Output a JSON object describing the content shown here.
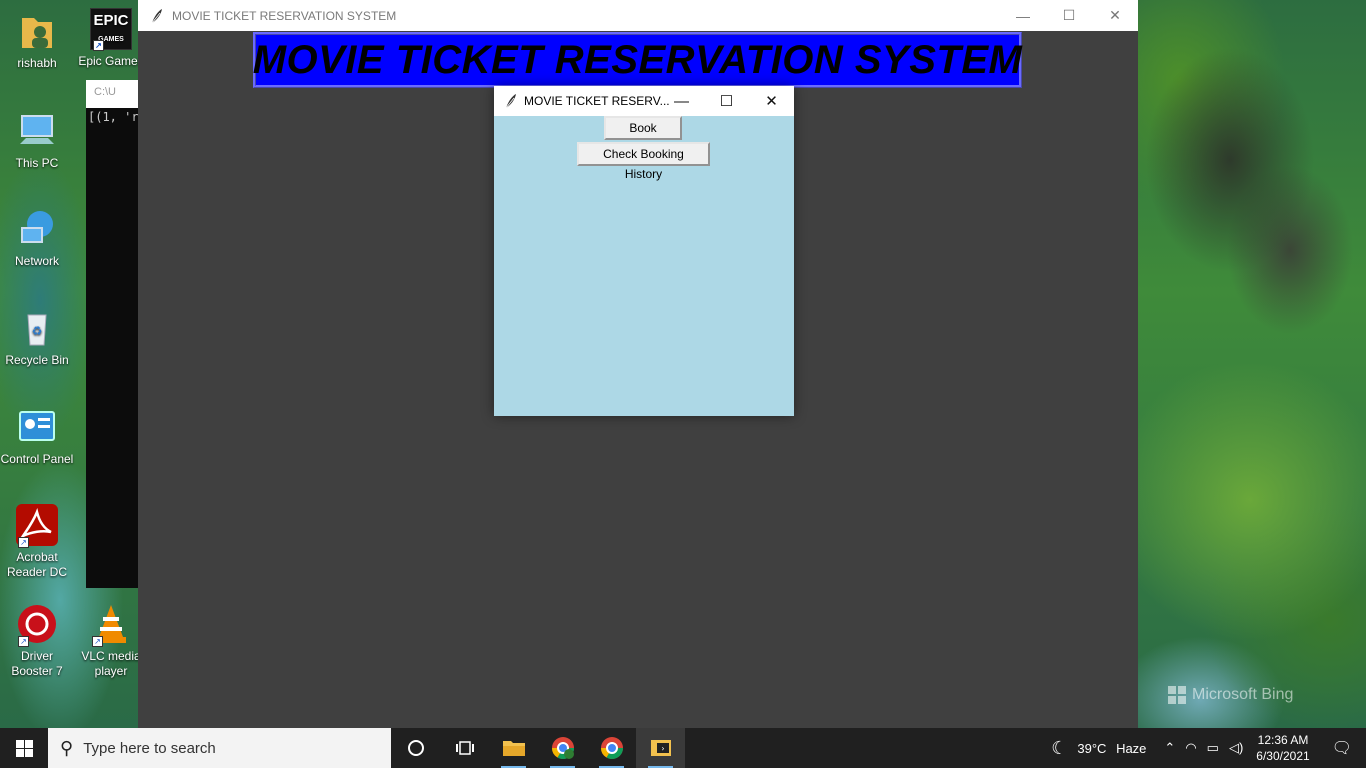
{
  "desktop": {
    "icons": [
      {
        "label": "rishabh"
      },
      {
        "label": "Epic Games"
      },
      {
        "label": "This PC"
      },
      {
        "label": "Network"
      },
      {
        "label": "Recycle Bin"
      },
      {
        "label": "Control Panel"
      },
      {
        "label": "Acrobat Reader DC"
      },
      {
        "label": "Driver Booster 7"
      },
      {
        "label": "VLC media player"
      }
    ],
    "wallpaper_brand": "Microsoft Bing",
    "epic_logo_text": "EPIC",
    "epic_logo_sub": "GAMES"
  },
  "console": {
    "title": "C:\\U",
    "output": "[(1, 'r"
  },
  "main_window": {
    "title": "MOVIE TICKET RESERVATION SYSTEM",
    "banner": "MOVIE TICKET RESERVATION SYSTEM",
    "colors": {
      "banner_bg": "#0000ff",
      "body_bg": "#404040"
    }
  },
  "dialog": {
    "title": "MOVIE TICKET RESERV...",
    "book_button": "Book Tickets",
    "history_button": "Check Booking History",
    "colors": {
      "body_bg": "#add8e6"
    }
  },
  "window_controls": {
    "minimize": "—",
    "maximize": "☐",
    "close": "✕"
  },
  "taskbar": {
    "search_placeholder": "Type here to search",
    "apps": [
      "cortana-icon",
      "task-view-icon",
      "file-explorer-icon",
      "chrome-profile-icon",
      "chrome-icon",
      "python-idle-icon"
    ],
    "weather": {
      "temp": "39°C",
      "condition": "Haze"
    },
    "clock": {
      "time": "12:36 AM",
      "date": "6/30/2021"
    }
  }
}
